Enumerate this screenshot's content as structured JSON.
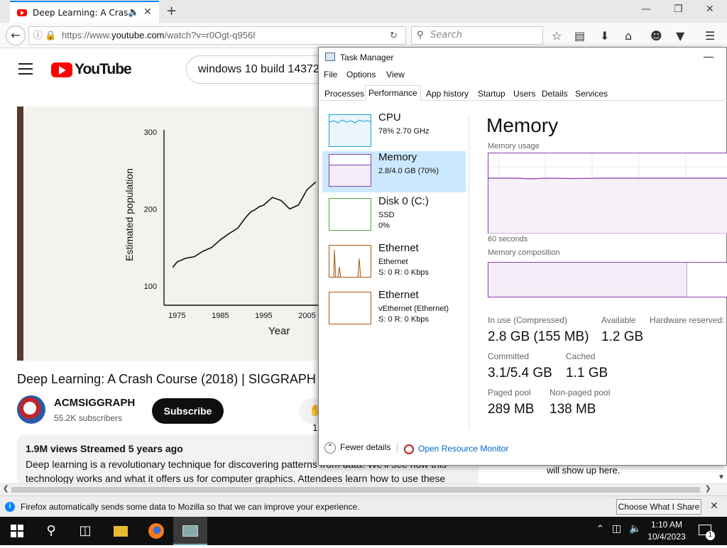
{
  "browser": {
    "tab_title": "Deep Learning: A Cras...",
    "url_prefix": "https://www.",
    "url_domain": "youtube.com",
    "url_path": "/watch?v=r0Ogt-q956I",
    "search_placeholder": "Search"
  },
  "youtube": {
    "logo": "YouTube",
    "search_value": "windows 10 build 14372",
    "video_title": "Deep Learning: A Crash Course (2018) | SIGGRAPH",
    "channel_name": "ACMSIGGRAPH",
    "subscribers": "55.2K subscribers",
    "subscribe_label": "Subscribe",
    "like_count": "1",
    "desc_meta": "1.9M views  Streamed 5 years ago",
    "desc_text": "Deep learning is a revolutionary technique for discovering patterns from data. We'll see how this technology works and what it offers us for computer graphics. Attendees learn how to use these",
    "chat_text": "when the stream was live will show up here.",
    "chart_data": {
      "type": "line",
      "xlabel": "Year",
      "ylabel": "Estimated population",
      "x_ticks": [
        "1975",
        "1985",
        "1995",
        "2005"
      ],
      "y_ticks": [
        "100",
        "200",
        "300"
      ],
      "ylim": [
        75,
        310
      ],
      "xlim": [
        1972,
        2010
      ],
      "x": [
        1974,
        1975,
        1977,
        1979,
        1981,
        1983,
        1985,
        1987,
        1989,
        1991,
        1992,
        1993,
        1994,
        1995,
        1997,
        1999,
        2001,
        2003,
        2005,
        2007
      ],
      "values": [
        124,
        131,
        136,
        138,
        145,
        150,
        160,
        168,
        175,
        190,
        196,
        199,
        203,
        205,
        215,
        211,
        200,
        205,
        225,
        235
      ]
    }
  },
  "notification": {
    "message": "Firefox automatically sends some data to Mozilla so that we can improve your experience.",
    "button": "Choose What I Share"
  },
  "taskbar": {
    "time": "1:10 AM",
    "date": "10/4/2023",
    "notification_count": "1"
  },
  "taskmanager": {
    "title": "Task Manager",
    "menus": [
      "File",
      "Options",
      "View"
    ],
    "tabs": [
      "Processes",
      "Performance",
      "App history",
      "Startup",
      "Users",
      "Details",
      "Services"
    ],
    "resources": [
      {
        "name": "CPU",
        "l1": "78%  2.70 GHz",
        "l2": ""
      },
      {
        "name": "Memory",
        "l1": "2.8/4.0 GB (70%)",
        "l2": ""
      },
      {
        "name": "Disk 0 (C:)",
        "l1": "SSD",
        "l2": "0%"
      },
      {
        "name": "Ethernet",
        "l1": "Ethernet",
        "l2": "S: 0  R: 0 Kbps"
      },
      {
        "name": "Ethernet",
        "l1": "vEthernet (Ethernet)",
        "l2": "S: 0  R: 0 Kbps"
      }
    ],
    "detail_title": "Memory",
    "usage_label": "Memory usage",
    "seconds_label": "60 seconds",
    "composition_label": "Memory composition",
    "stats": {
      "in_use_label": "In use (Compressed)",
      "in_use": "2.8 GB (155 MB)",
      "available_label": "Available",
      "available": "1.2 GB",
      "hw_label": "Hardware reserved:",
      "committed_label": "Committed",
      "committed": "3.1/5.4 GB",
      "cached_label": "Cached",
      "cached": "1.1 GB",
      "paged_label": "Paged pool",
      "paged": "289 MB",
      "nonpaged_label": "Non-paged pool",
      "nonpaged": "138 MB"
    },
    "fewer_details": "Fewer details",
    "resource_monitor": "Open Resource Monitor",
    "colors": {
      "cpu": "#17a0d8",
      "memory": "#8b3fa8",
      "disk": "#4da63a",
      "ethernet": "#a85a14"
    }
  }
}
